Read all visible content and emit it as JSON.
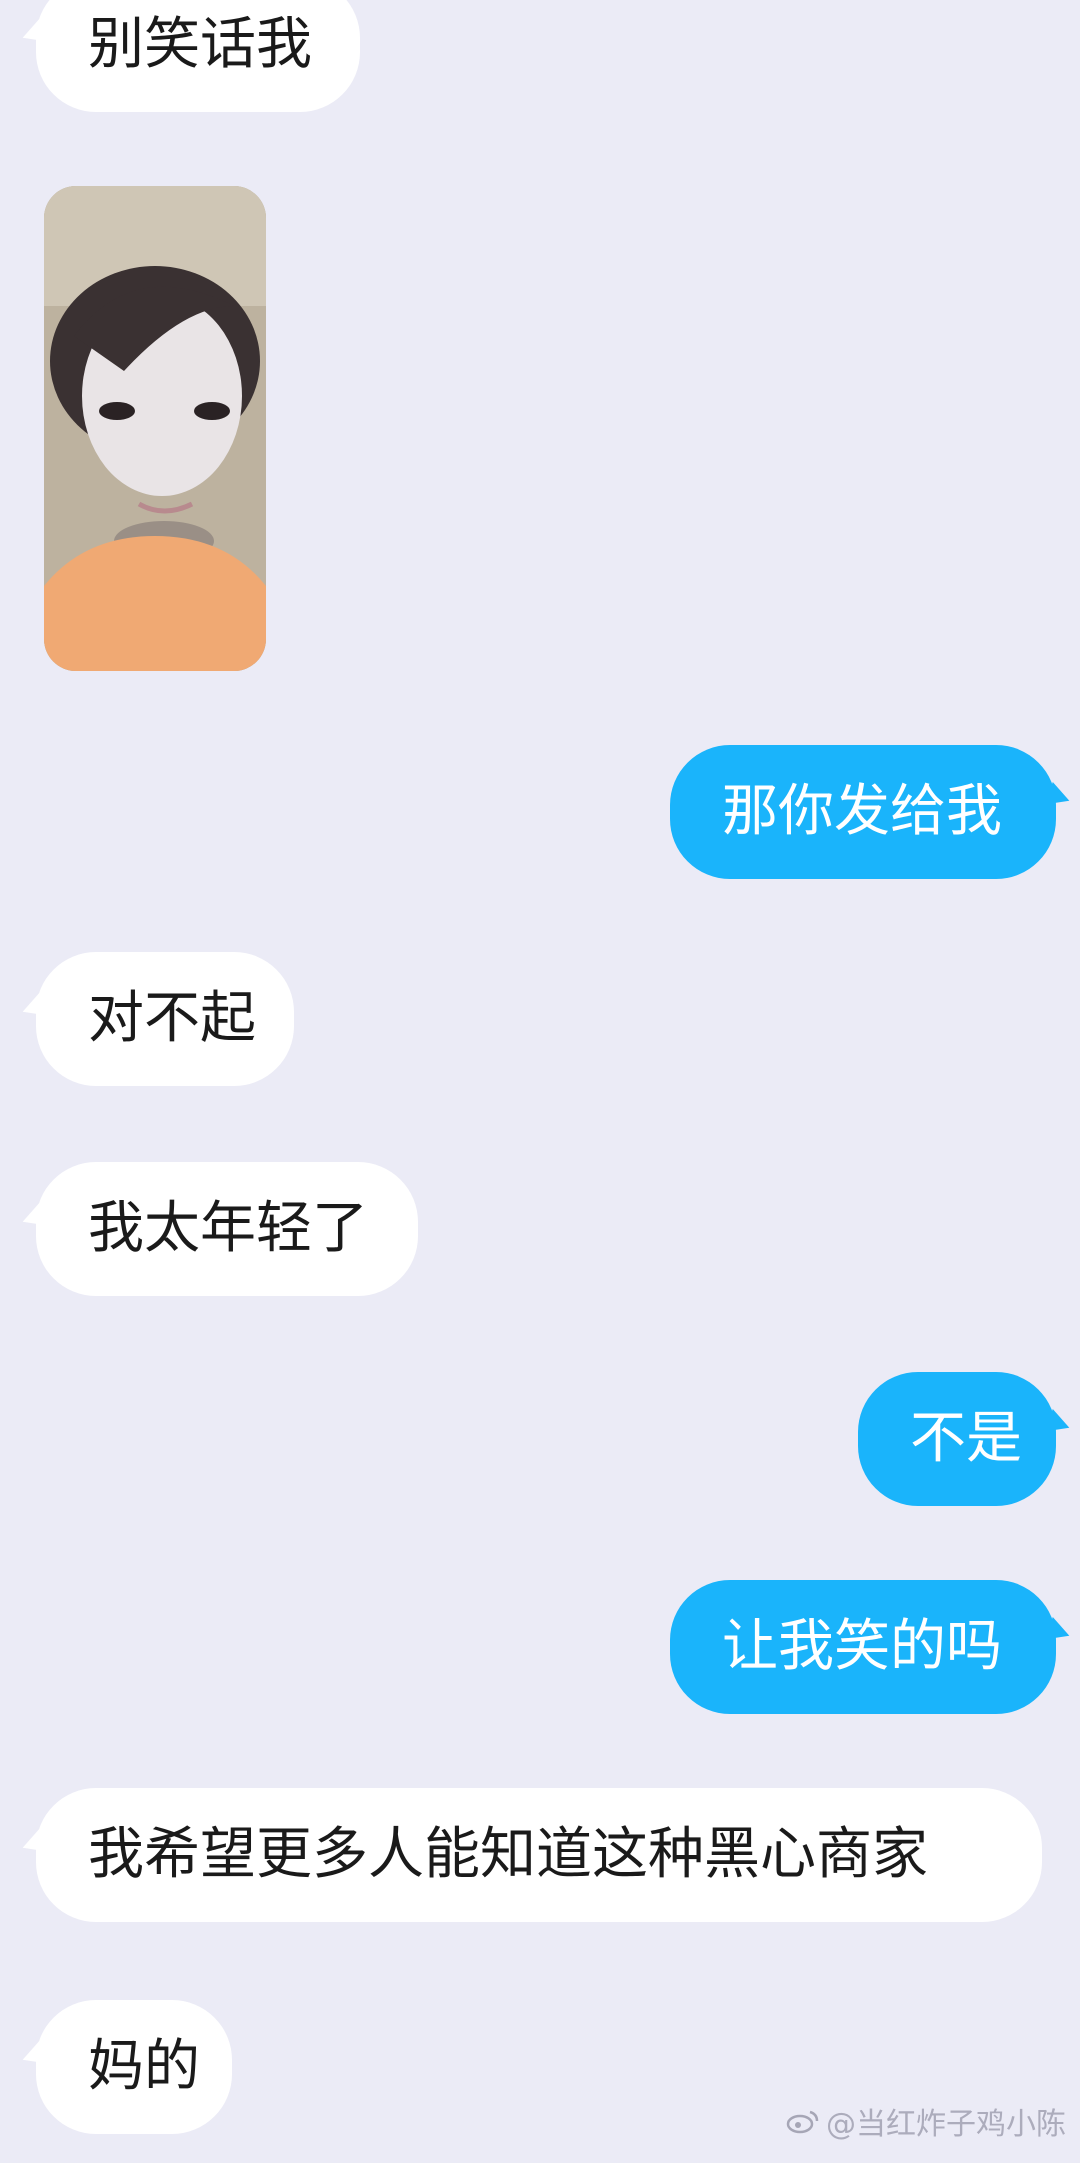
{
  "messages": {
    "m1": "别笑话我",
    "m3": "那你发给我",
    "m4": "对不起",
    "m5": "我太年轻了",
    "m6": "不是",
    "m7": "让我笑的吗",
    "m8": "我希望更多人能知道这种黑心商家",
    "m9": "妈的"
  },
  "image_message": {
    "icon": "photo-image"
  },
  "watermark": {
    "text": "@当红炸子鸡小陈",
    "icon": "weibo-icon"
  },
  "colors": {
    "background": "#ebebf6",
    "incoming_bubble": "#ffffff",
    "outgoing_bubble": "#1ab4fb"
  }
}
